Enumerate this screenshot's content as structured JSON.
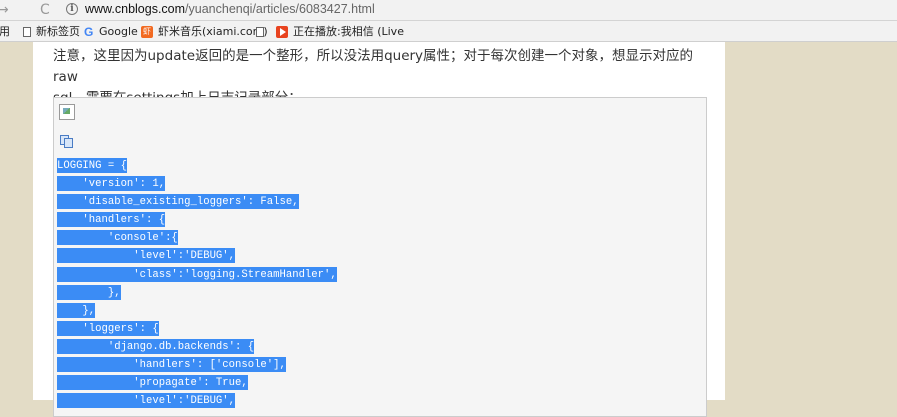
{
  "browser": {
    "url_host": "www.cnblogs.com",
    "url_path": "/yuanchenqi/articles/6083427.html",
    "bookmarks": [
      {
        "label": "应用",
        "icon": "apps-icon"
      },
      {
        "label": "新标签页",
        "icon": "page-icon"
      },
      {
        "label": "Google",
        "icon": "google-icon"
      },
      {
        "label": "虾米音乐(xiami.com)",
        "icon": "xiami-icon"
      },
      {
        "label": "",
        "icon": "page-icon"
      },
      {
        "label": "正在播放:我相信 (Live",
        "icon": "play-icon"
      }
    ]
  },
  "article": {
    "paragraph_line1": "注意，这里因为update返回的是一个整形，所以没法用query属性；对于每次创建一个对象，想显示对应的raw",
    "paragraph_line2": "sql，需要在settings加上日志记录部分："
  },
  "code": {
    "lines": [
      "LOGGING = {",
      "    'version': 1,",
      "    'disable_existing_loggers': False,",
      "    'handlers': {",
      "        'console':{",
      "            'level':'DEBUG',",
      "            'class':'logging.StreamHandler',",
      "        },",
      "    },",
      "    'loggers': {",
      "        'django.db.backends': {",
      "            'handlers': ['console'],",
      "            'propagate': True,",
      "            'level':'DEBUG',"
    ]
  }
}
